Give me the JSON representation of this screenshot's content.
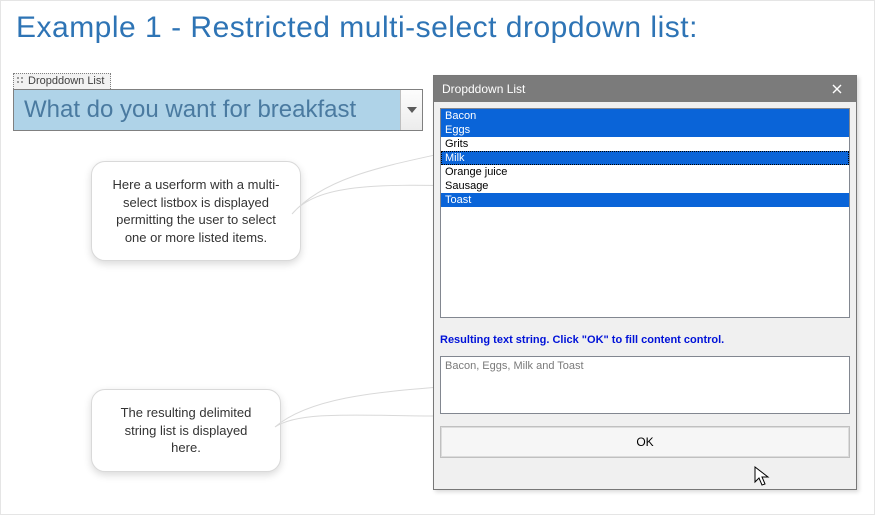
{
  "heading": "Example 1 - Restricted multi-select dropdown list:",
  "content_control": {
    "tab_label": "Dropddown List",
    "prompt": "What do you want for breakfast"
  },
  "callouts": {
    "top": "Here a userform with a multi-select listbox is displayed permitting the user to select one or more listed items.",
    "bottom": "The resulting delimited string list is displayed here."
  },
  "dialog": {
    "title": "Dropddown List",
    "items": [
      {
        "label": "Bacon",
        "selected": true,
        "focused": false
      },
      {
        "label": "Eggs",
        "selected": true,
        "focused": false
      },
      {
        "label": "Grits",
        "selected": false,
        "focused": false
      },
      {
        "label": "Milk",
        "selected": true,
        "focused": true
      },
      {
        "label": "Orange juice",
        "selected": false,
        "focused": false
      },
      {
        "label": "Sausage",
        "selected": false,
        "focused": false
      },
      {
        "label": "Toast",
        "selected": true,
        "focused": false
      }
    ],
    "instruction": "Resulting text string. Click \"OK\" to fill content control.",
    "result": "Bacon, Eggs, Milk and Toast",
    "ok_label": "OK"
  }
}
